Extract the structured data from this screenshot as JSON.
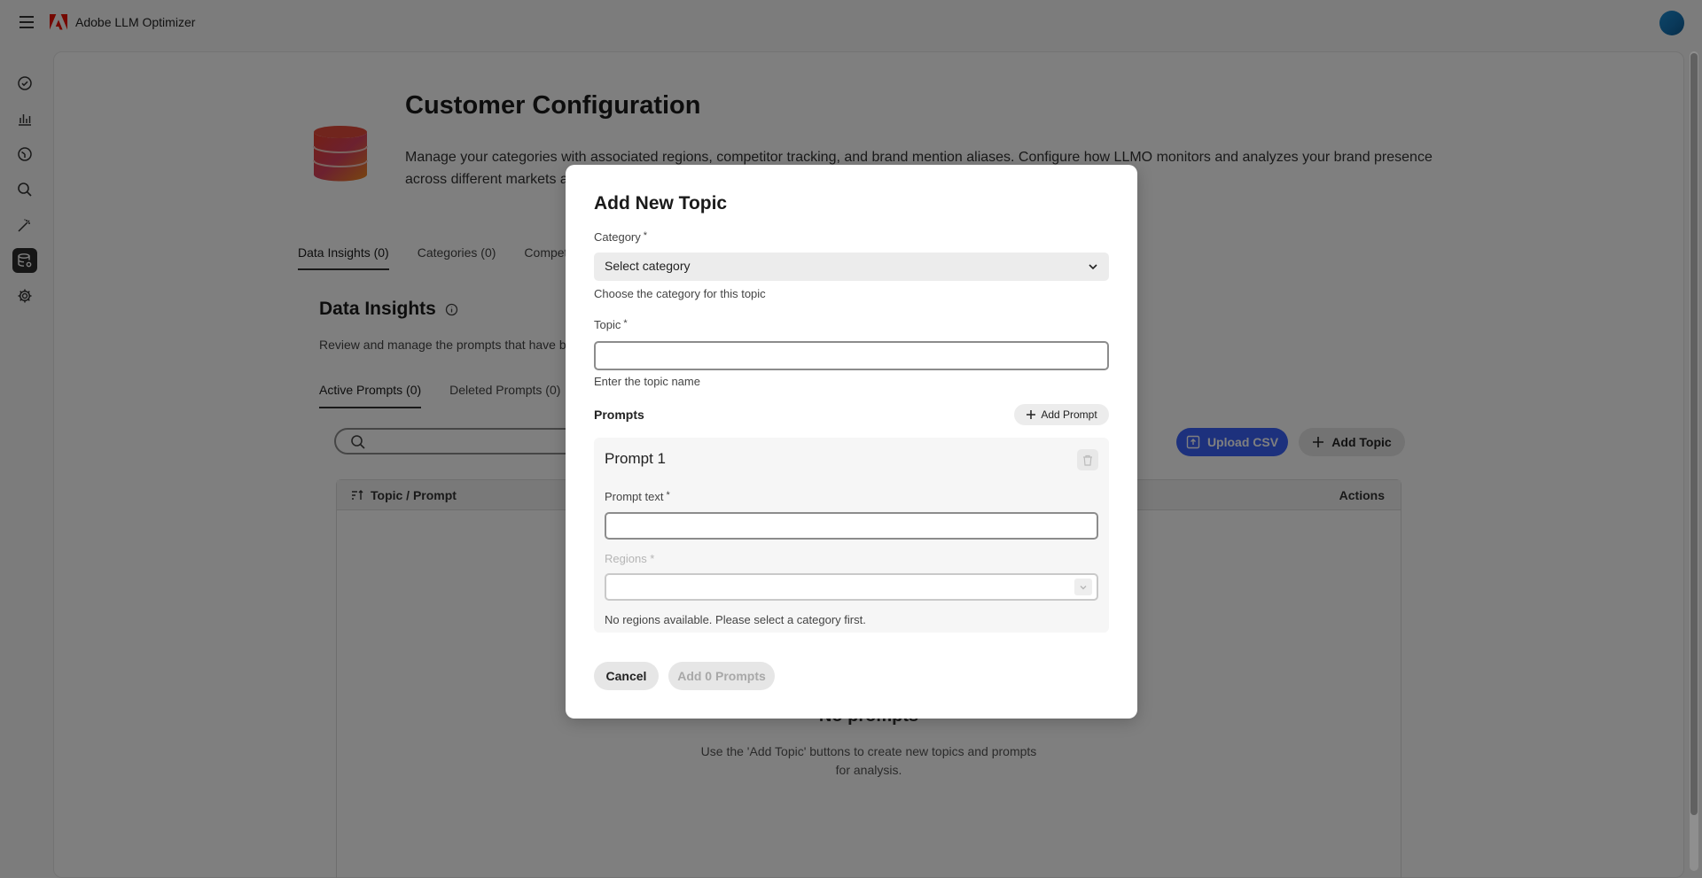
{
  "app": {
    "title": "Adobe LLM Optimizer"
  },
  "icons": {
    "menu": "hamburger-icon",
    "logo": "adobe-logo-icon",
    "rail": [
      "checkmark-circle-icon",
      "bar-chart-icon",
      "clock-dial-icon",
      "search-icon",
      "magic-wand-icon",
      "database-settings-icon",
      "gear-icon"
    ]
  },
  "colors": {
    "accent": "#3b63fb",
    "adobe_red": "#eb1000"
  },
  "page": {
    "title": "Customer Configuration",
    "description": "Manage your categories with associated regions, competitor tracking, and brand mention aliases. Configure how LLMO monitors and analyzes your brand presence across different markets and competitive lan"
  },
  "tabs": [
    {
      "label": "Data Insights (0)"
    },
    {
      "label": "Categories (0)"
    },
    {
      "label": "Competito"
    }
  ],
  "section": {
    "title": "Data Insights",
    "description": "Review and manage the prompts that have been"
  },
  "subtabs": [
    {
      "label": "Active Prompts (0)"
    },
    {
      "label": "Deleted Prompts (0)"
    }
  ],
  "actions": {
    "upload_csv": "Upload CSV",
    "add_topic": "Add Topic"
  },
  "table": {
    "col_topic": "Topic / Prompt",
    "col_actions": "Actions",
    "empty_title": "No prompts",
    "empty_desc": "Use the 'Add Topic' buttons to create new topics and prompts for analysis."
  },
  "dialog": {
    "title": "Add New Topic",
    "category_label": "Category",
    "category_placeholder": "Select category",
    "category_help": "Choose the category for this topic",
    "topic_label": "Topic",
    "topic_value": "",
    "topic_help": "Enter the topic name",
    "prompts_label": "Prompts",
    "add_prompt": "Add Prompt",
    "required_mark": "*",
    "prompt": {
      "title": "Prompt 1",
      "text_label": "Prompt text",
      "text_value": "",
      "regions_label": "Regions *",
      "regions_note": "No regions available. Please select a category first."
    },
    "cancel": "Cancel",
    "submit": "Add 0 Prompts"
  }
}
